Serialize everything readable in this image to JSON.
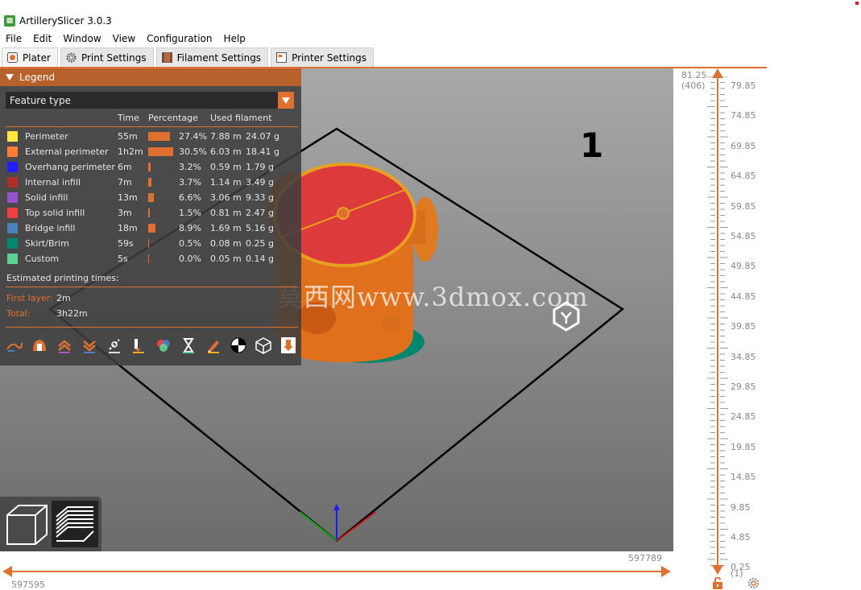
{
  "window": {
    "title": "ArtillerySlicer 3.0.3"
  },
  "menu": [
    "File",
    "Edit",
    "Window",
    "View",
    "Configuration",
    "Help"
  ],
  "tabs": [
    {
      "label": "Plater",
      "active": true
    },
    {
      "label": "Print Settings",
      "active": false
    },
    {
      "label": "Filament Settings",
      "active": false
    },
    {
      "label": "Printer Settings",
      "active": false
    }
  ],
  "legend": {
    "title": "Legend",
    "view_type": "Feature type",
    "columns": {
      "time": "Time",
      "percentage": "Percentage",
      "used_filament": "Used filament"
    },
    "features": [
      {
        "name": "Perimeter",
        "color": "#ffe641",
        "time": "55m",
        "percent": "27.4%",
        "fraction": 0.274,
        "length": "7.88 m",
        "weight": "24.07 g"
      },
      {
        "name": "External perimeter",
        "color": "#ff7d38",
        "time": "1h2m",
        "percent": "30.5%",
        "fraction": 0.305,
        "length": "6.03 m",
        "weight": "18.41 g"
      },
      {
        "name": "Overhang perimeter",
        "color": "#1f1fff",
        "time": "6m",
        "percent": "3.2%",
        "fraction": 0.032,
        "length": "0.59 m",
        "weight": "1.79 g"
      },
      {
        "name": "Internal infill",
        "color": "#b03029",
        "time": "7m",
        "percent": "3.7%",
        "fraction": 0.037,
        "length": "1.14 m",
        "weight": "3.49 g"
      },
      {
        "name": "Solid infill",
        "color": "#9654cc",
        "time": "13m",
        "percent": "6.6%",
        "fraction": 0.066,
        "length": "3.06 m",
        "weight": "9.33 g"
      },
      {
        "name": "Top solid infill",
        "color": "#f04040",
        "time": "3m",
        "percent": "1.5%",
        "fraction": 0.015,
        "length": "0.81 m",
        "weight": "2.47 g"
      },
      {
        "name": "Bridge infill",
        "color": "#4d80ba",
        "time": "18m",
        "percent": "8.9%",
        "fraction": 0.089,
        "length": "1.69 m",
        "weight": "5.16 g"
      },
      {
        "name": "Skirt/Brim",
        "color": "#00876e",
        "time": "59s",
        "percent": "0.5%",
        "fraction": 0.005,
        "length": "0.08 m",
        "weight": "0.25 g"
      },
      {
        "name": "Custom",
        "color": "#5ed194",
        "time": "5s",
        "percent": "0.0%",
        "fraction": 0.0,
        "length": "0.05 m",
        "weight": "0.14 g"
      }
    ],
    "estimated_label": "Estimated printing times:",
    "first_layer_label": "First layer:",
    "first_layer_value": "2m",
    "total_label": "Total:",
    "total_value": "3h22m"
  },
  "scene": {
    "plate_number": "1",
    "watermark": "莫西网www.3dmox.com"
  },
  "horizontal_slider": {
    "max": "597789",
    "min": "597595"
  },
  "vertical_slider": {
    "top_value": "81.25",
    "top_layer": "(406)",
    "ticks": [
      "79.85",
      "74.85",
      "69.85",
      "64.85",
      "59.85",
      "54.85",
      "49.85",
      "44.85",
      "39.85",
      "34.85",
      "29.85",
      "24.85",
      "19.85",
      "14.85",
      "9.85",
      "4.85",
      "0.25"
    ],
    "bottom_layer": "(1)"
  }
}
